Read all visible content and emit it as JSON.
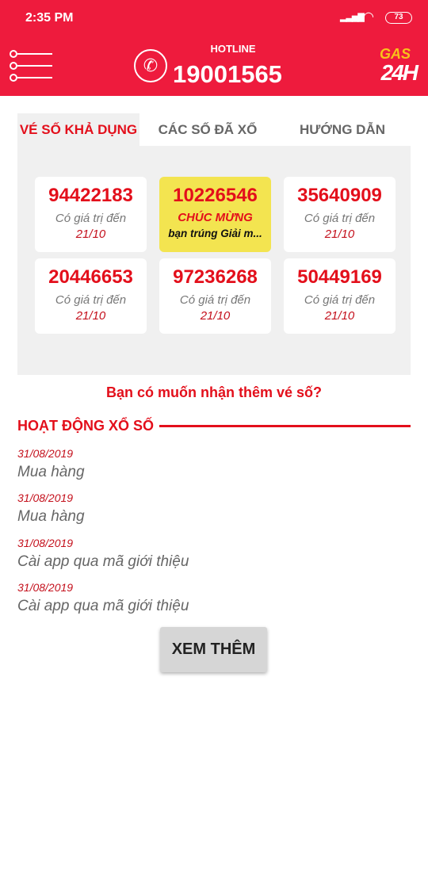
{
  "status": {
    "time": "2:35 PM",
    "battery": "73"
  },
  "header": {
    "hotline_label": "HOTLINE",
    "hotline_number": "19001565",
    "logo_text_top": "GAS",
    "logo_text_bottom": "24H"
  },
  "tabs": [
    {
      "label": "VÉ SỐ KHẢ DỤNG"
    },
    {
      "label": "CÁC SỐ ĐÃ XỔ"
    },
    {
      "label": "HƯỚNG DẪN"
    }
  ],
  "tickets": [
    {
      "number": "94422183",
      "valid_label": "Có giá trị đến",
      "date": "21/10"
    },
    {
      "number": "10226546",
      "congrats": "CHÚC MỪNG",
      "message": "bạn trúng Giải m..."
    },
    {
      "number": "35640909",
      "valid_label": "Có giá trị đến",
      "date": "21/10"
    },
    {
      "number": "20446653",
      "valid_label": "Có giá trị đến",
      "date": "21/10"
    },
    {
      "number": "97236268",
      "valid_label": "Có giá trị đến",
      "date": "21/10"
    },
    {
      "number": "50449169",
      "valid_label": "Có giá trị đến",
      "date": "21/10"
    }
  ],
  "more_tickets_prompt": "Bạn có muốn nhận thêm vé số?",
  "activity": {
    "title": "HOẠT ĐỘNG XỔ SỐ",
    "items": [
      {
        "date": "31/08/2019",
        "text": "Mua hàng"
      },
      {
        "date": "31/08/2019",
        "text": "Mua hàng"
      },
      {
        "date": "31/08/2019",
        "text": "Cài app qua mã giới thiệu"
      },
      {
        "date": "31/08/2019",
        "text": "Cài app qua mã giới thiệu"
      }
    ]
  },
  "see_more_label": "XEM THÊM",
  "colors": {
    "brand": "#ee1b3d",
    "accent": "#e30f1b",
    "win": "#f3e450"
  }
}
